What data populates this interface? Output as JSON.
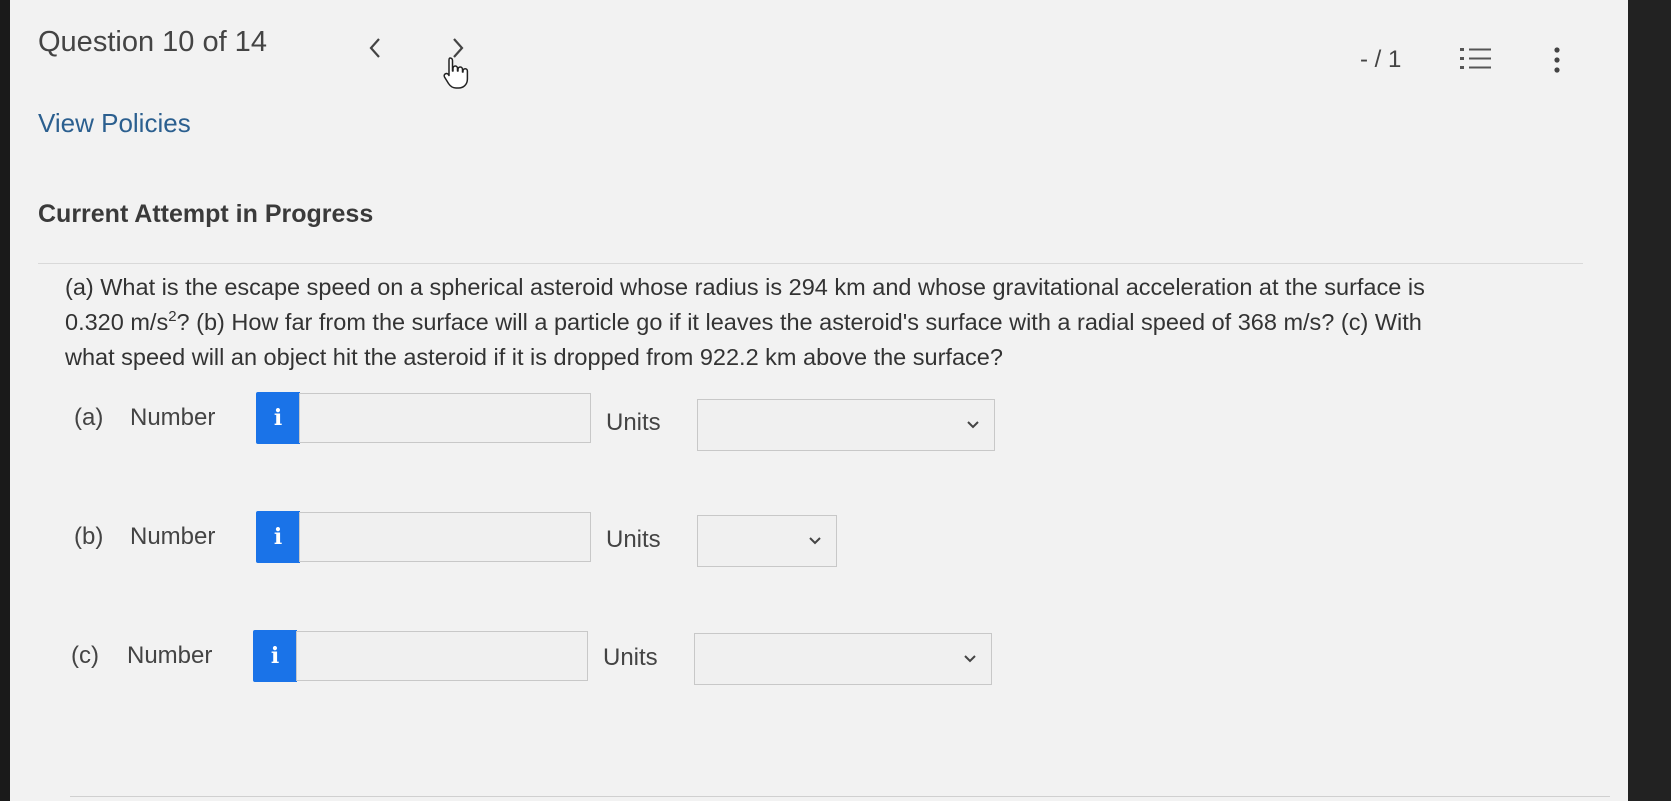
{
  "header": {
    "question_title": "Question 10 of 14",
    "prev_icon": "chevron-left-icon",
    "next_icon": "chevron-right-icon",
    "cursor_icon": "hand-pointer-icon",
    "score": "- / 1",
    "list_icon": "numbered-list-icon",
    "more_icon": "vertical-ellipsis-icon"
  },
  "links": {
    "view_policies": "View Policies"
  },
  "attempt": {
    "heading": "Current Attempt in Progress"
  },
  "question": {
    "line1": "(a) What is the escape speed on a spherical asteroid whose radius is 294 km and whose gravitational acceleration at the surface is",
    "line2_pre": "0.320 m/s",
    "line2_sup": "2",
    "line2_post": "? (b) How far from the surface will a particle go if it leaves the asteroid's surface with a radial speed of 368 m/s? (c) With",
    "line3": "what speed will an object hit the asteroid if it is dropped from 922.2 km above the surface?"
  },
  "answers": [
    {
      "part": "(a)",
      "number_label": "Number",
      "info_label": "i",
      "number_value": "",
      "units_label": "Units",
      "units_value": ""
    },
    {
      "part": "(b)",
      "number_label": "Number",
      "info_label": "i",
      "number_value": "",
      "units_label": "Units",
      "units_value": ""
    },
    {
      "part": "(c)",
      "number_label": "Number",
      "info_label": "i",
      "number_value": "",
      "units_label": "Units",
      "units_value": ""
    }
  ],
  "colors": {
    "info_button": "#1a73e8",
    "link": "#2b5f8f",
    "background": "#f2f2f2"
  }
}
